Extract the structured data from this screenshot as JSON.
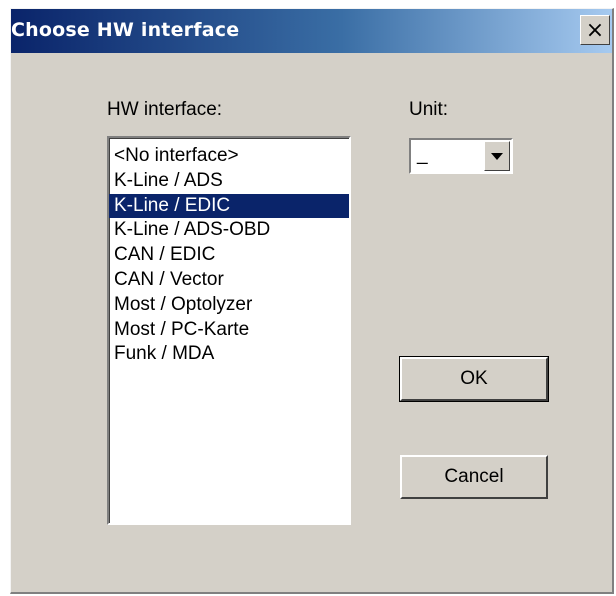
{
  "window": {
    "title": "Choose HW interface",
    "close_glyph": "×",
    "close_icon": "close-icon"
  },
  "hw_interface": {
    "label": "HW interface:",
    "items": [
      "<No interface>",
      "K-Line / ADS",
      "K-Line / EDIC",
      "K-Line / ADS-OBD",
      "CAN / EDIC",
      "CAN / Vector",
      "Most / Optolyzer",
      "Most / PC-Karte",
      "Funk / MDA"
    ],
    "selected": "K-Line / EDIC"
  },
  "unit": {
    "label": "Unit:",
    "value": "_",
    "dropdown_icon": "chevron-down-icon"
  },
  "buttons": {
    "ok": "OK",
    "cancel": "Cancel"
  },
  "colors": {
    "selection": "#0a246a",
    "dialog_bg": "#d4d0c8",
    "titlebar_start": "#0a246a",
    "titlebar_end": "#a6caf0"
  }
}
